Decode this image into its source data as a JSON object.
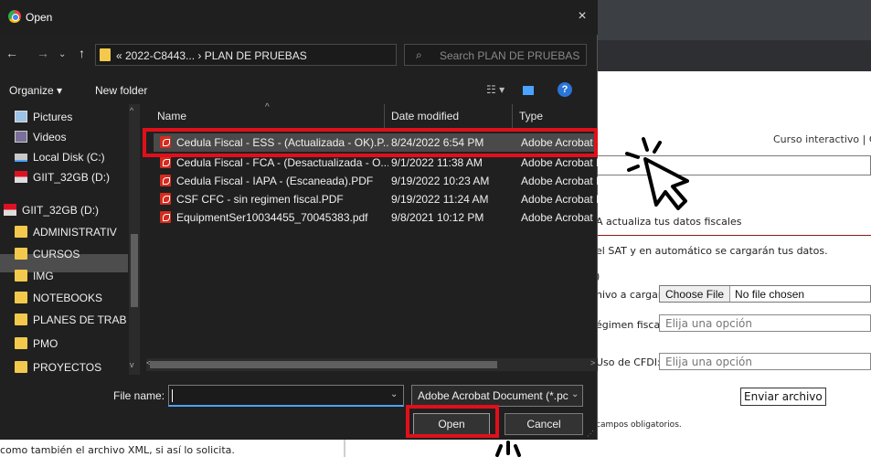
{
  "dialog": {
    "title": "Open",
    "close_icon": "×",
    "breadcrumb": "« 2022-C8443... › PLAN DE PRUEBAS",
    "search_placeholder": "Search PLAN DE PRUEBAS",
    "organize_label": "Organize ▾",
    "new_folder_label": "New folder"
  },
  "nav_pane": {
    "items": [
      {
        "label": "Pictures",
        "icon": "pictures-icon"
      },
      {
        "label": "Videos",
        "icon": "videos-icon"
      },
      {
        "label": "Local Disk (C:)",
        "icon": "disk-icon"
      },
      {
        "label": "GIIT_32GB (D:)",
        "icon": "usb-drive-icon"
      },
      {
        "label": "GIIT_32GB (D:)",
        "icon": "usb-drive-icon"
      },
      {
        "label": "ADMINISTRATIV",
        "icon": "folder-icon"
      },
      {
        "label": "CURSOS",
        "icon": "folder-icon"
      },
      {
        "label": "IMG",
        "icon": "folder-icon"
      },
      {
        "label": "NOTEBOOKS",
        "icon": "folder-icon"
      },
      {
        "label": "PLANES DE TRAB",
        "icon": "folder-icon"
      },
      {
        "label": "PMO",
        "icon": "folder-icon"
      },
      {
        "label": "PROYECTOS",
        "icon": "folder-icon"
      }
    ]
  },
  "file_list": {
    "columns": [
      "Name",
      "Date modified",
      "Type"
    ],
    "rows": [
      {
        "name": "Cedula Fiscal - ESS - (Actualizada - OK).P...",
        "date": "8/24/2022 6:54 PM",
        "type": "Adobe Acrobat"
      },
      {
        "name": "Cedula Fiscal - FCA - (Desactualizada - O...",
        "date": "9/1/2022 11:38 AM",
        "type": "Adobe Acrobat I"
      },
      {
        "name": "Cedula Fiscal - IAPA - (Escaneada).PDF",
        "date": "9/19/2022 10:23 AM",
        "type": "Adobe Acrobat I"
      },
      {
        "name": "CSF CFC - sin regimen fiscal.PDF",
        "date": "9/19/2022 11:24 AM",
        "type": "Adobe Acrobat I"
      },
      {
        "name": "EquipmentSer10034455_70045383.pdf",
        "date": "9/8/2021 10:12 PM",
        "type": "Adobe Acrobat"
      }
    ]
  },
  "bottom": {
    "file_name_label": "File name:",
    "file_name_value": "",
    "file_type": "Adobe Acrobat Document (*.pc",
    "open_label": "Open",
    "cancel_label": "Cancel"
  },
  "background_page": {
    "course_text": "Curso interactivo | Co",
    "actualiza_text": "A actualiza tus datos fiscales",
    "sat_text": "el SAT y en automático se cargarán tus datos.",
    "d_text": ")",
    "archivo_label": "hivo a cargar:",
    "choose_file": "Choose File",
    "no_file": "No file chosen",
    "regimen_label": "égimen fiscal:",
    "regimen_placeholder": "Elija una opción",
    "uso_label": "Uso de CFDI:",
    "uso_placeholder": "Elija una opción",
    "enviar_label": "Enviar archivo",
    "obligatorios_text": "campos obligatorios.",
    "xml_text": "como también el archivo XML, si así lo solicita."
  },
  "colors": {
    "highlight": "#e0101a",
    "dialog_bg": "#202020",
    "selection": "#4a4a4a"
  }
}
